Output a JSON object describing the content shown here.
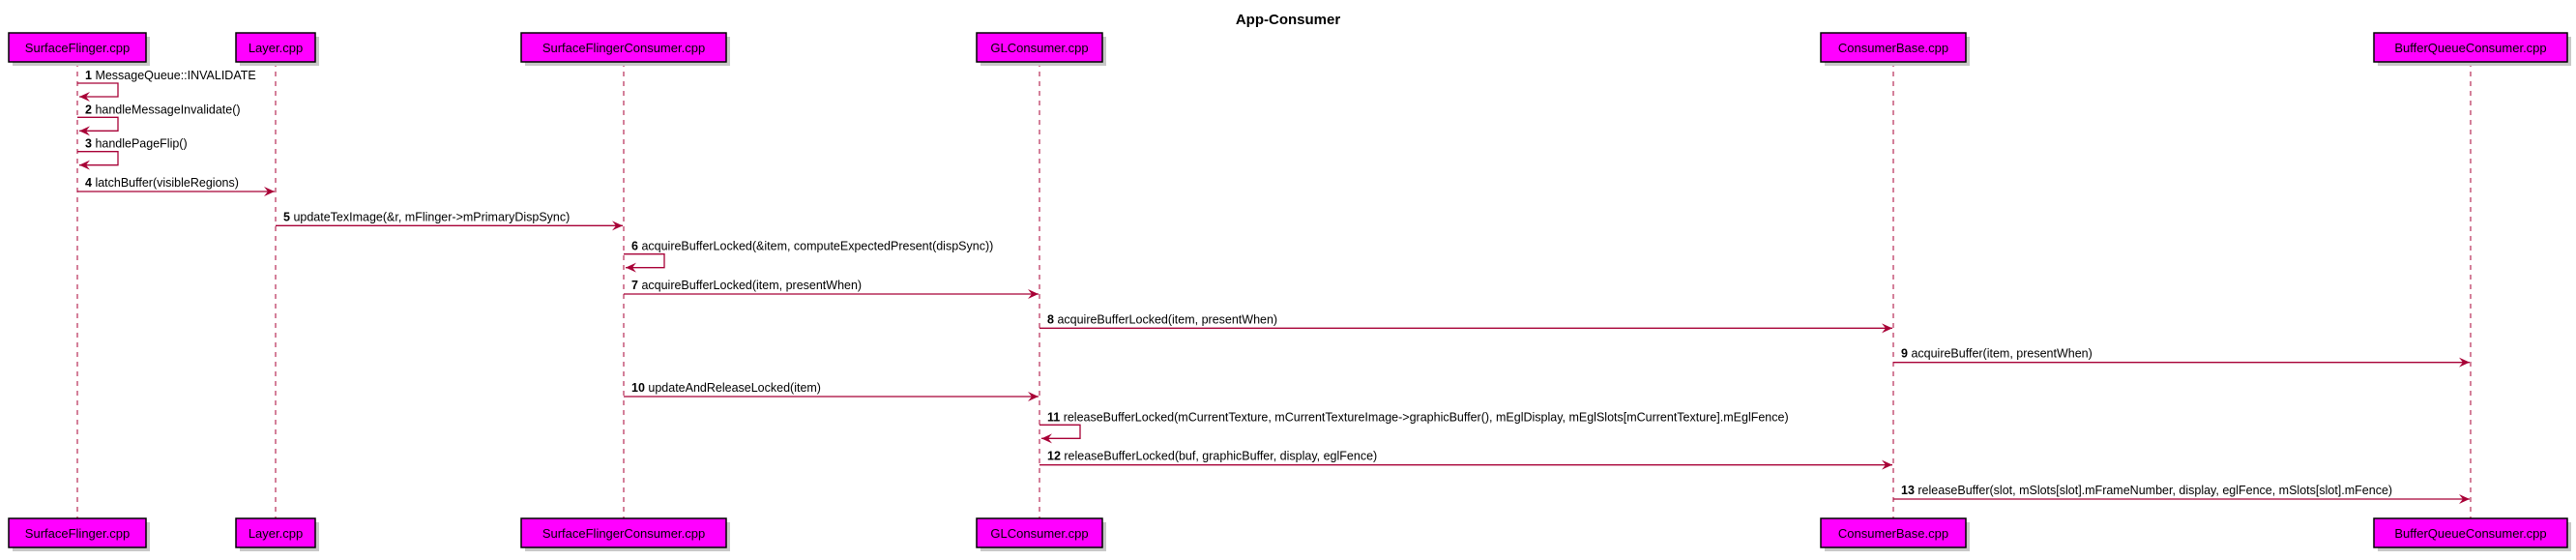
{
  "title": "App-Consumer",
  "colors": {
    "participant_fill": "#ff00ff",
    "participant_border": "#000000",
    "arrow": "#a80036",
    "lifeline": "#a80036",
    "shadow": "#c8c8c8"
  },
  "participants": [
    {
      "label": "SurfaceFlinger.cpp"
    },
    {
      "label": "Layer.cpp"
    },
    {
      "label": "SurfaceFlingerConsumer.cpp"
    },
    {
      "label": "GLConsumer.cpp"
    },
    {
      "label": "ConsumerBase.cpp"
    },
    {
      "label": "BufferQueueConsumer.cpp"
    }
  ],
  "messages": [
    {
      "num": "1",
      "from": 0,
      "to": 0,
      "text": "MessageQueue::INVALIDATE"
    },
    {
      "num": "2",
      "from": 0,
      "to": 0,
      "text": "handleMessageInvalidate()"
    },
    {
      "num": "3",
      "from": 0,
      "to": 0,
      "text": "handlePageFlip()"
    },
    {
      "num": "4",
      "from": 0,
      "to": 1,
      "text": "latchBuffer(visibleRegions)"
    },
    {
      "num": "5",
      "from": 1,
      "to": 2,
      "text": "updateTexImage(&r, mFlinger->mPrimaryDispSync)"
    },
    {
      "num": "6",
      "from": 2,
      "to": 2,
      "text": "acquireBufferLocked(&item, computeExpectedPresent(dispSync))"
    },
    {
      "num": "7",
      "from": 2,
      "to": 3,
      "text": "acquireBufferLocked(item, presentWhen)"
    },
    {
      "num": "8",
      "from": 3,
      "to": 4,
      "text": "acquireBufferLocked(item, presentWhen)"
    },
    {
      "num": "9",
      "from": 4,
      "to": 5,
      "text": "acquireBuffer(item, presentWhen)"
    },
    {
      "num": "10",
      "from": 2,
      "to": 3,
      "text": "updateAndReleaseLocked(item)"
    },
    {
      "num": "11",
      "from": 3,
      "to": 3,
      "text": "releaseBufferLocked(mCurrentTexture, mCurrentTextureImage->graphicBuffer(), mEglDisplay, mEglSlots[mCurrentTexture].mEglFence)"
    },
    {
      "num": "12",
      "from": 3,
      "to": 4,
      "text": "releaseBufferLocked(buf, graphicBuffer, display, eglFence)"
    },
    {
      "num": "13",
      "from": 4,
      "to": 5,
      "text": "releaseBuffer(slot, mSlots[slot].mFrameNumber, display, eglFence, mSlots[slot].mFence)"
    }
  ]
}
